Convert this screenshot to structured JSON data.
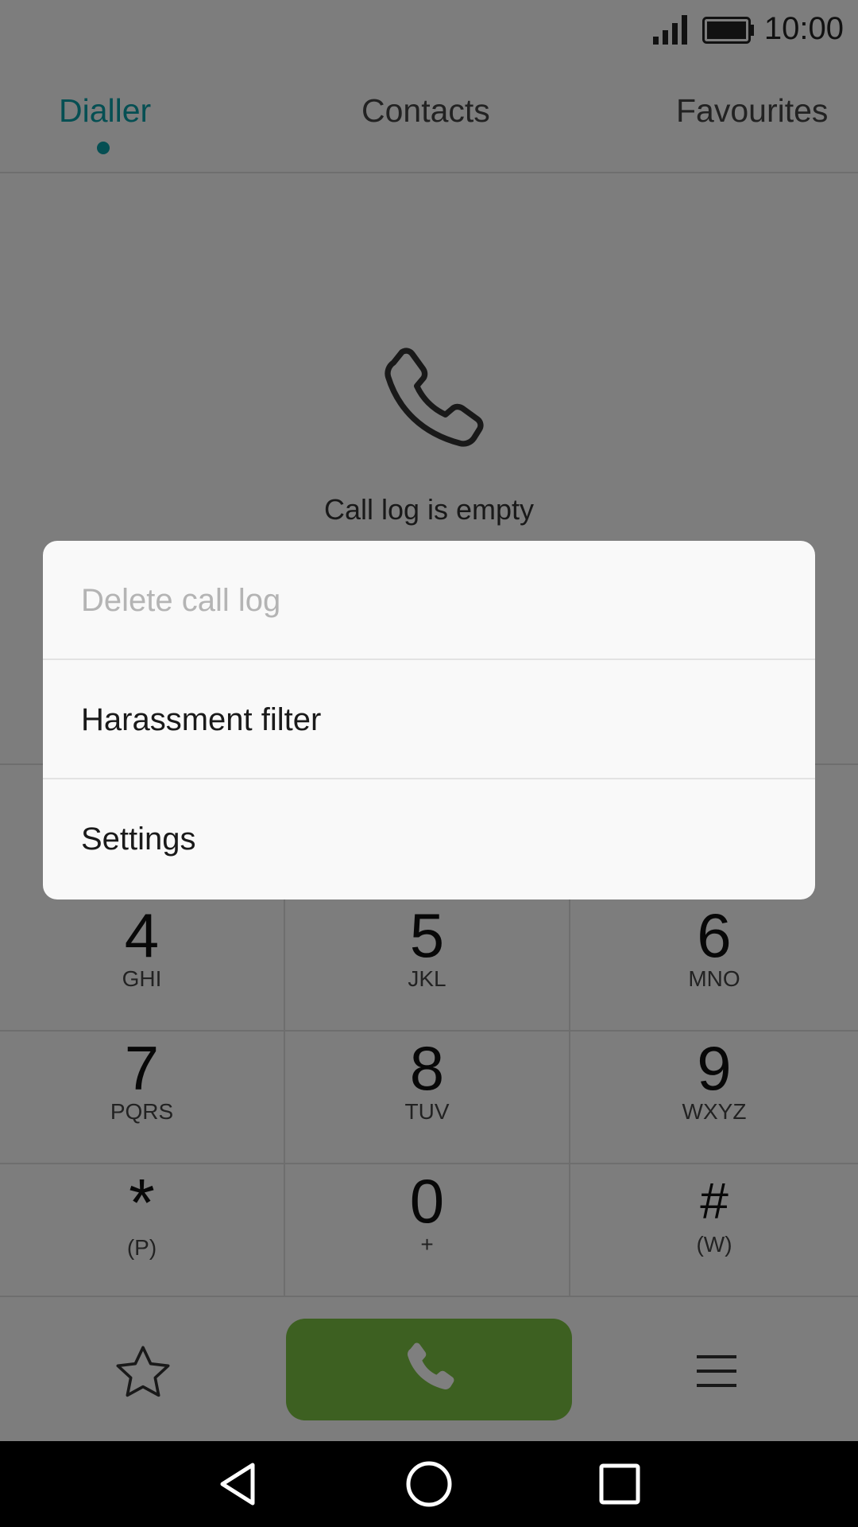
{
  "status": {
    "time": "10:00",
    "signal_icon": "signal-icon",
    "battery_icon": "battery-icon"
  },
  "tabs": [
    {
      "label": "Dialler",
      "active": true
    },
    {
      "label": "Contacts",
      "active": false
    },
    {
      "label": "Favourites",
      "active": false
    }
  ],
  "empty_state": {
    "icon": "phone-icon",
    "text": "Call log is empty"
  },
  "keypad": {
    "k4": {
      "digit": "4",
      "letters": "GHI"
    },
    "k5": {
      "digit": "5",
      "letters": "JKL"
    },
    "k6": {
      "digit": "6",
      "letters": "MNO"
    },
    "k7": {
      "digit": "7",
      "letters": "PQRS"
    },
    "k8": {
      "digit": "8",
      "letters": "TUV"
    },
    "k9": {
      "digit": "9",
      "letters": "WXYZ"
    },
    "kstar": {
      "digit": "*",
      "letters": "(P)"
    },
    "k0": {
      "digit": "0",
      "letters": "+"
    },
    "khash": {
      "digit": "#",
      "letters": "(W)"
    }
  },
  "actions": {
    "favourite_icon": "star-icon",
    "call_icon": "phone-icon",
    "menu_icon": "menu-icon",
    "call_color": "#7bc043"
  },
  "menu": {
    "items": [
      {
        "label": "Delete call log",
        "enabled": false
      },
      {
        "label": "Harassment filter",
        "enabled": true
      },
      {
        "label": "Settings",
        "enabled": true
      }
    ]
  },
  "nav": {
    "back_icon": "back-icon",
    "home_icon": "home-icon",
    "recents_icon": "recents-icon"
  },
  "colors": {
    "accent": "#0a9ea6",
    "scrim": "rgba(0,0,0,0.5)"
  }
}
